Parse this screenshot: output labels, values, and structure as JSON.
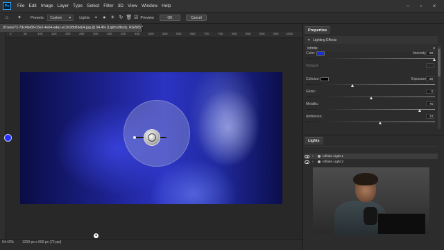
{
  "app": {
    "logo": "Ps",
    "menu": [
      "File",
      "Edit",
      "Image",
      "Layer",
      "Type",
      "Select",
      "Filter",
      "3D",
      "View",
      "Window",
      "Help"
    ]
  },
  "options_bar": {
    "presets_label": "Presets:",
    "presets_value": "Custom",
    "lights_label": "Lights:",
    "preview_label": "Preview",
    "ok_label": "OK",
    "cancel_label": "Cancel"
  },
  "document": {
    "tab_title": "d7ceeo72-7dc49e88-03e2-4eb4-a4a1-e19c08d65eb4.jpg @ 94.4% (Light Effects, RGB/8) *",
    "ruler_ticks": [
      "0",
      "50",
      "100",
      "150",
      "200",
      "250",
      "300",
      "350",
      "400",
      "450",
      "500",
      "550",
      "600",
      "650",
      "700",
      "750",
      "800",
      "850",
      "900",
      "950",
      "1000",
      "1050"
    ]
  },
  "status": {
    "zoom": "94.42%",
    "dims": "1200 px x 600 px (72 ppi)"
  },
  "properties": {
    "tab_label": "Properties",
    "header": "Lighting Effects",
    "light_type": "Infinite",
    "color_label": "Color:",
    "color_value": "#1a2ee0",
    "intensity_label": "Intensity:",
    "intensity_value": "98",
    "hotspot_label": "Hotspot:",
    "colorize_label": "Colorize:",
    "colorize_value": "#000000",
    "exposure_label": "Exposure:",
    "exposure_value": "-30",
    "gloss_label": "Gloss:",
    "gloss_value": "0",
    "metallic_label": "Metallic:",
    "metallic_value": "75",
    "ambience_label": "Ambience:",
    "ambience_value": "13"
  },
  "lights": {
    "tab_label": "Lights",
    "items": [
      "Infinite Light 1",
      "Infinite Light 2"
    ]
  }
}
